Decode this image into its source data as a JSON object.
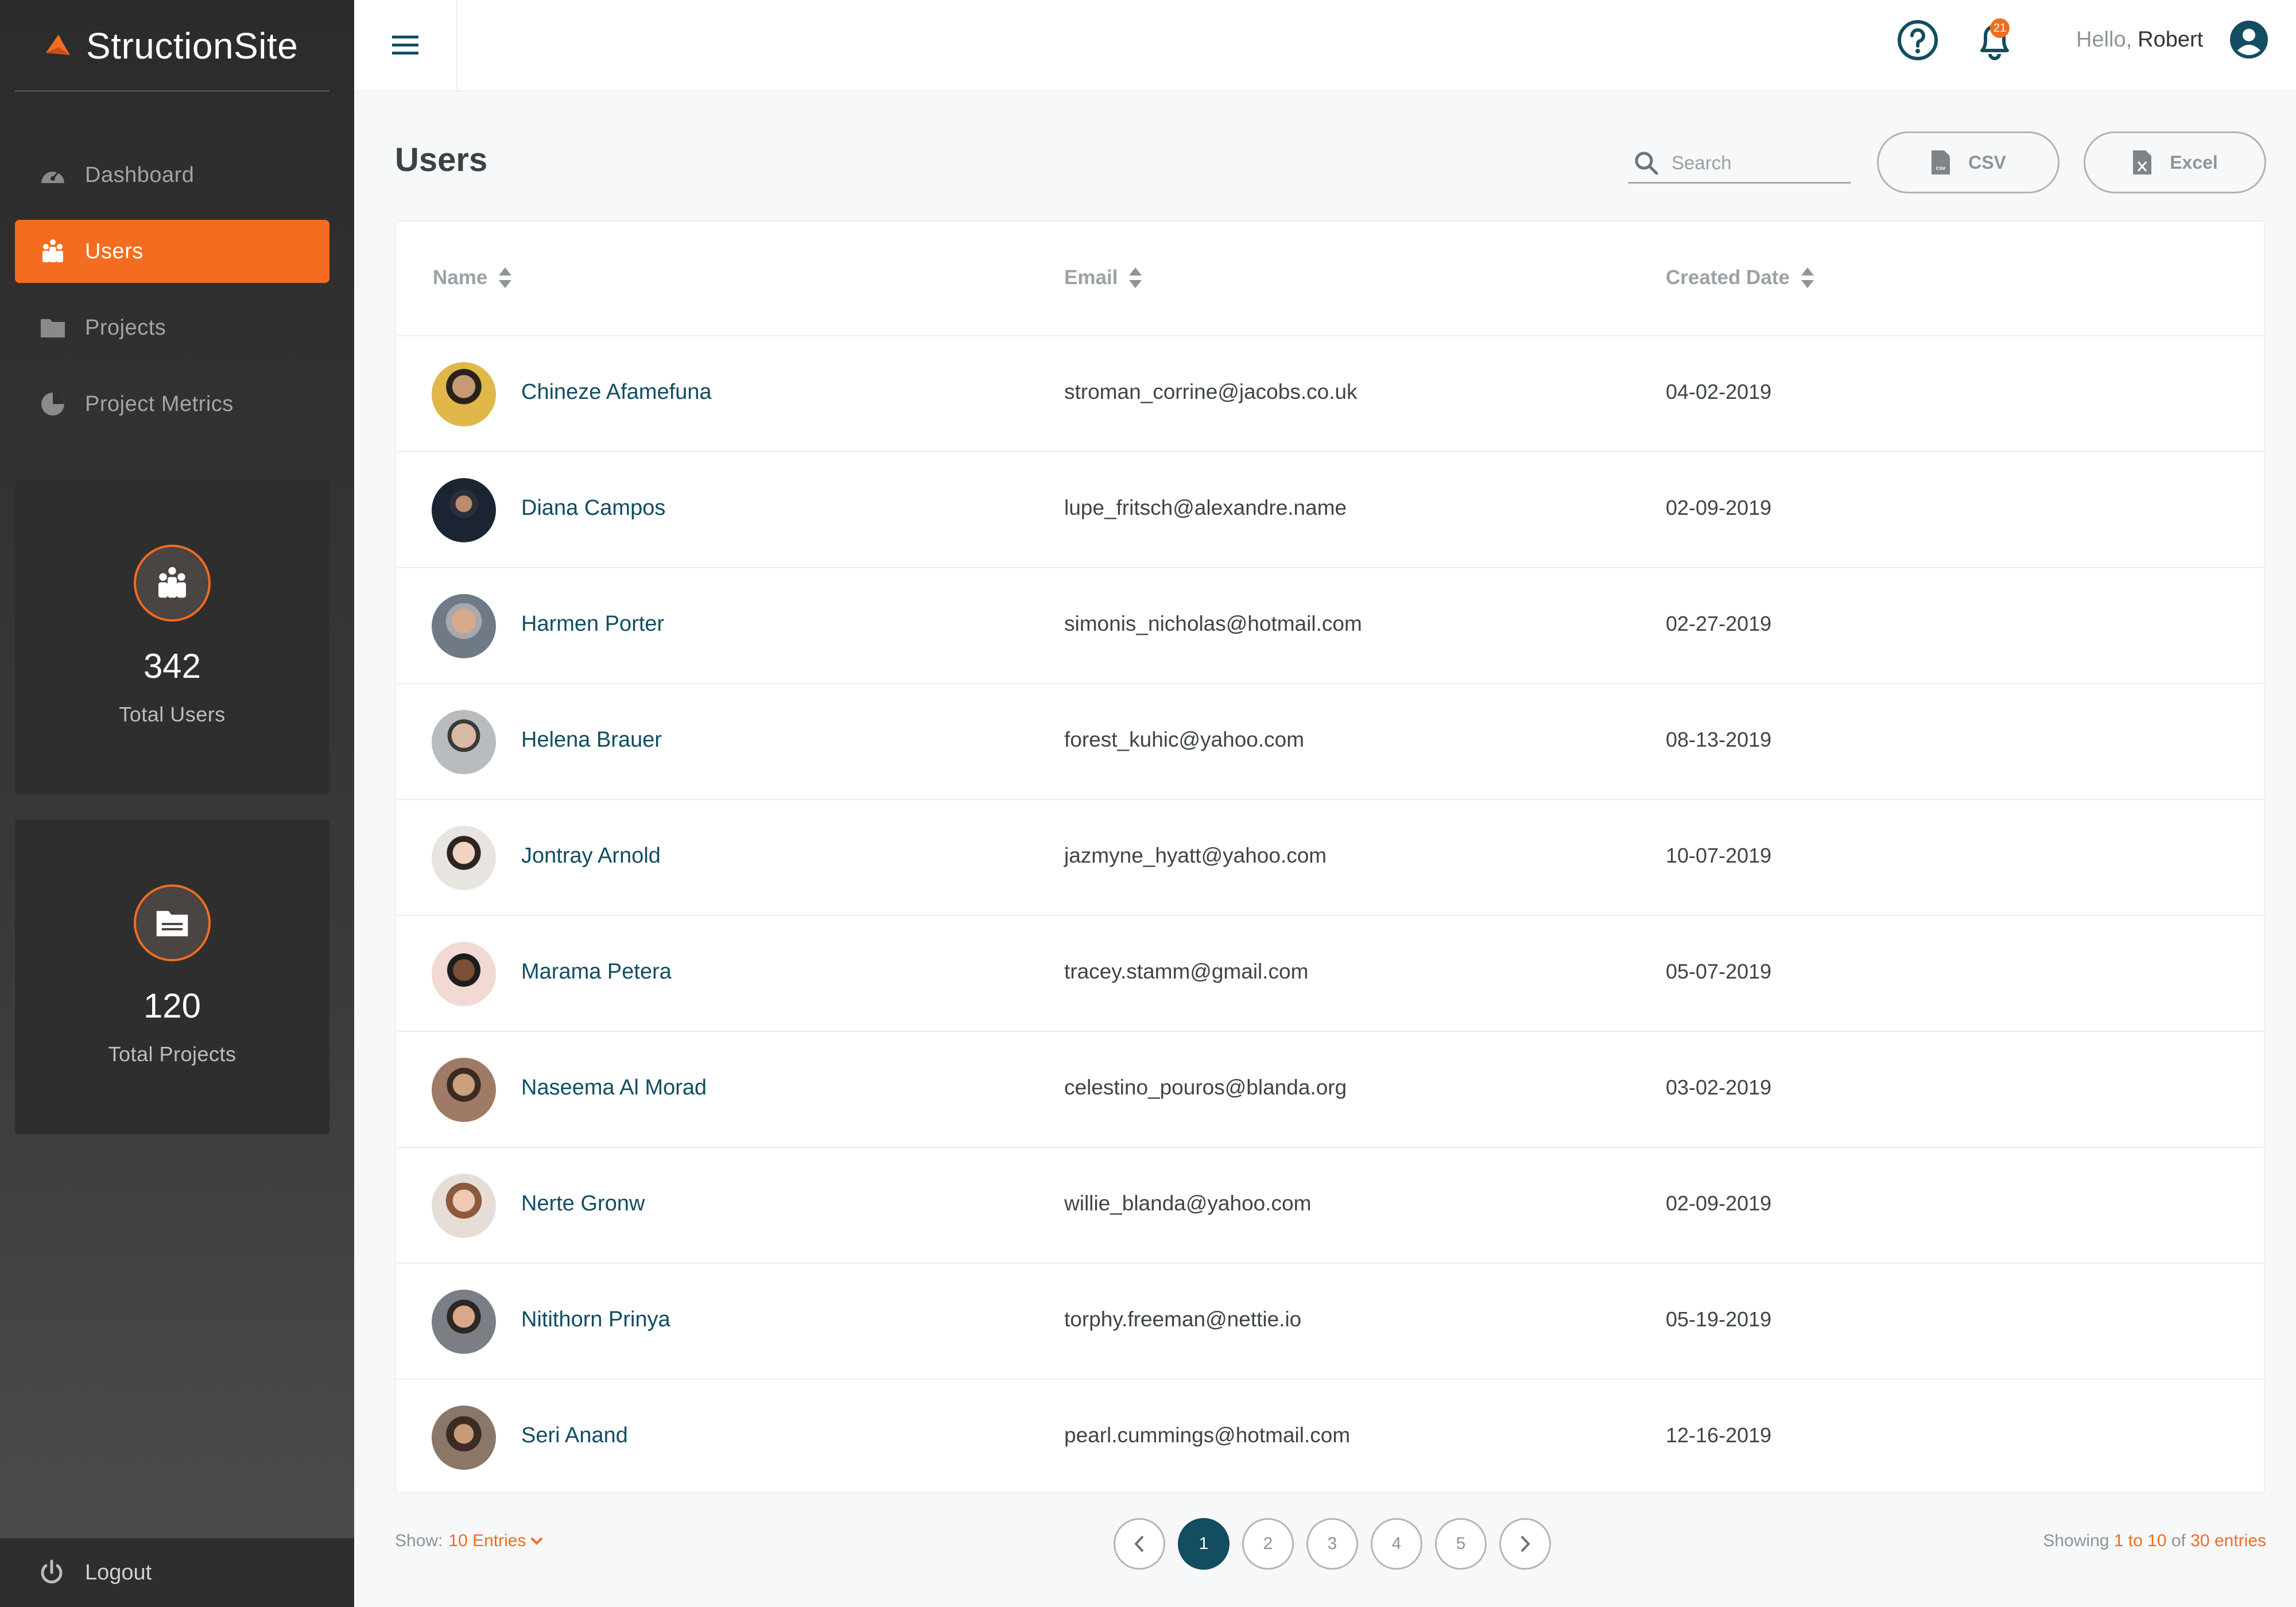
{
  "app": {
    "name": "StructionSite",
    "accent_color": "#f36c1f",
    "primary_color": "#124d61"
  },
  "sidebar": {
    "items": [
      {
        "label": "Dashboard",
        "icon": "gauge-icon"
      },
      {
        "label": "Users",
        "icon": "users-icon",
        "active": true
      },
      {
        "label": "Projects",
        "icon": "folder-icon"
      },
      {
        "label": "Project Metrics",
        "icon": "pie-chart-icon"
      }
    ],
    "stats": [
      {
        "value": "342",
        "label": "Total Users",
        "icon": "users-icon"
      },
      {
        "value": "120",
        "label": "Total Projects",
        "icon": "folder-icon"
      }
    ],
    "logout_label": "Logout"
  },
  "topbar": {
    "notification_count": "21",
    "greeting_prefix": "Hello,",
    "user_name": "Robert"
  },
  "page": {
    "title": "Users",
    "search_placeholder": "Search",
    "csv_label": "CSV",
    "excel_label": "Excel"
  },
  "table": {
    "columns": [
      "Name",
      "Email",
      "Created Date"
    ],
    "rows": [
      {
        "name": "Chineze Afamefuna",
        "email": "stroman_corrine@jacobs.co.uk",
        "date": "04-02-2019"
      },
      {
        "name": "Diana Campos",
        "email": "lupe_fritsch@alexandre.name",
        "date": "02-09-2019"
      },
      {
        "name": "Harmen Porter",
        "email": "simonis_nicholas@hotmail.com",
        "date": "02-27-2019"
      },
      {
        "name": "Helena Brauer",
        "email": "forest_kuhic@yahoo.com",
        "date": "08-13-2019"
      },
      {
        "name": "Jontray Arnold",
        "email": "jazmyne_hyatt@yahoo.com",
        "date": "10-07-2019"
      },
      {
        "name": "Marama Petera",
        "email": "tracey.stamm@gmail.com",
        "date": "05-07-2019"
      },
      {
        "name": "Naseema Al Morad",
        "email": "celestino_pouros@blanda.org",
        "date": "03-02-2019"
      },
      {
        "name": "Nerte Gronw",
        "email": "willie_blanda@yahoo.com",
        "date": "02-09-2019"
      },
      {
        "name": "Nitithorn Prinya",
        "email": "torphy.freeman@nettie.io",
        "date": "05-19-2019"
      },
      {
        "name": "Seri Anand",
        "email": "pearl.cummings@hotmail.com",
        "date": "12-16-2019"
      }
    ]
  },
  "footer": {
    "show_label": "Show:",
    "entries_option": "10 Entries",
    "pages": [
      "1",
      "2",
      "3",
      "4",
      "5"
    ],
    "current_page": "1",
    "showing_prefix": "Showing",
    "showing_range": "1 to 10",
    "showing_of": "of",
    "showing_total": "30 entries"
  }
}
